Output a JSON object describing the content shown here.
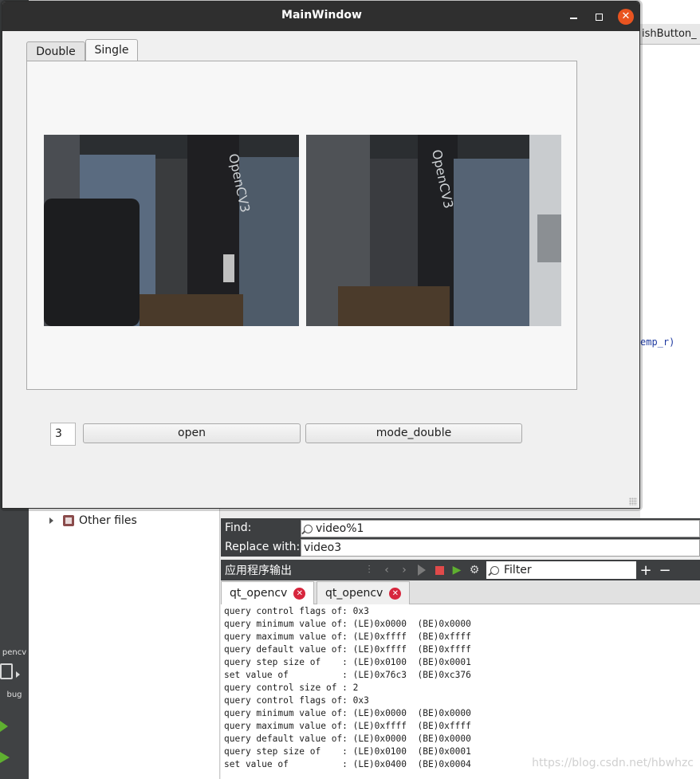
{
  "window": {
    "title": "MainWindow",
    "tabs": [
      {
        "label": "Double",
        "active": false
      },
      {
        "label": "Single",
        "active": true
      }
    ],
    "camera_count_value": "3",
    "open_button": "open",
    "mode_button": "mode_double"
  },
  "ide": {
    "left_bar": {
      "kit_label": "pencv",
      "mode_label": "bug"
    },
    "project_tree": {
      "other_files": "Other files"
    },
    "editor": {
      "tab_fragment": "ishButton_",
      "code_fragment": "emp_r)"
    },
    "find": {
      "find_label": "Find:",
      "find_value": "video%1",
      "replace_label": "Replace with:",
      "replace_value": "video3"
    },
    "output": {
      "title": "应用程序输出",
      "filter_placeholder": "Filter",
      "tabs": [
        "qt_opencv",
        "qt_opencv"
      ],
      "lines": [
        "query control flags of: 0x3",
        "query minimum value of: (LE)0x0000  (BE)0x0000",
        "query maximum value of: (LE)0xffff  (BE)0xffff",
        "query default value of: (LE)0xffff  (BE)0xffff",
        "query step size of    : (LE)0x0100  (BE)0x0001",
        "set value of          : (LE)0x76c3  (BE)0xc376",
        "query control size of : 2",
        "query control flags of: 0x3",
        "query minimum value of: (LE)0x0000  (BE)0x0000",
        "query maximum value of: (LE)0xffff  (BE)0xffff",
        "query default value of: (LE)0x0000  (BE)0x0000",
        "query step size of    : (LE)0x0100  (BE)0x0001",
        "set value of          : (LE)0x0400  (BE)0x0004"
      ]
    },
    "watermark": "https://blog.csdn.net/hbwhzc"
  },
  "colors": {
    "titlebar": "#2f2f2f",
    "close_button": "#e95420",
    "ide_dark": "#3d3f41",
    "tab_close": "#d7263d"
  }
}
